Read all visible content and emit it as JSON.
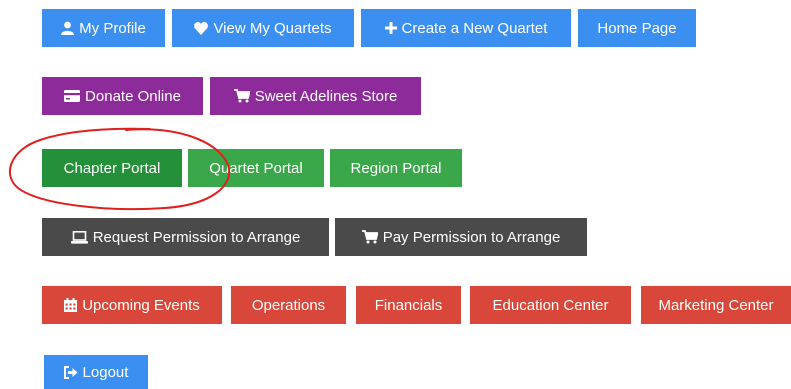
{
  "row1": {
    "my_profile": "My Profile",
    "view_quartets": "View My Quartets",
    "create_quartet": "Create a New Quartet",
    "home_page": "Home Page"
  },
  "row2": {
    "donate": "Donate Online",
    "store": "Sweet Adelines Store"
  },
  "row3": {
    "chapter_portal": "Chapter Portal",
    "quartet_portal": "Quartet Portal",
    "region_portal": "Region Portal"
  },
  "row4": {
    "request_permission": "Request Permission to Arrange",
    "pay_permission": "Pay Permission to Arrange"
  },
  "row5": {
    "upcoming_events": "Upcoming Events",
    "operations": "Operations",
    "financials": "Financials",
    "education_center": "Education Center",
    "marketing_center": "Marketing Center"
  },
  "row6": {
    "logout": "Logout"
  },
  "colors": {
    "blue": "#3b8ff0",
    "purple": "#8c2b99",
    "green": "#3aa84a",
    "green_selected": "#24903a",
    "dark": "#4a4a4a",
    "red": "#d9473a",
    "annotation": "#e02020"
  },
  "icons": {
    "my_profile": "user-icon",
    "view_quartets": "heart-icon",
    "create_quartet": "plus-icon",
    "donate": "credit-card-icon",
    "store": "cart-icon",
    "request_permission": "laptop-icon",
    "pay_permission": "cart-icon",
    "upcoming_events": "calendar-icon",
    "logout": "sign-out-icon"
  },
  "annotation": {
    "shape": "hand-drawn-ellipse",
    "highlights": "Chapter Portal"
  }
}
